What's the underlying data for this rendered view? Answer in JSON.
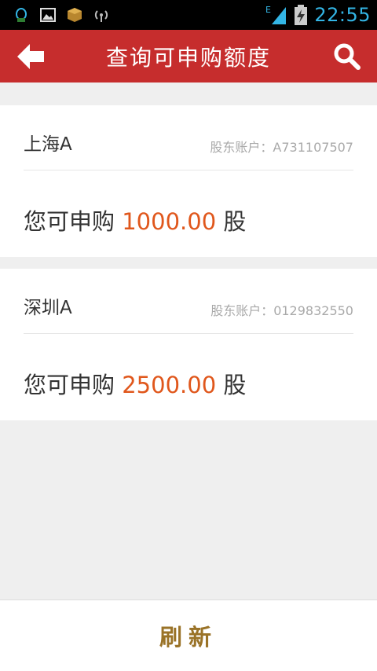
{
  "status_bar": {
    "time": "22:55",
    "network_type": "E",
    "icons": [
      "qq-icon",
      "image-icon",
      "package-icon",
      "wireless-icon",
      "signal-icon",
      "battery-charging-icon"
    ]
  },
  "header": {
    "title": "查询可申购额度",
    "back_icon": "arrow-left-icon",
    "search_icon": "search-icon",
    "bg_color": "#c62d2d"
  },
  "accounts": [
    {
      "market": "上海A",
      "account_label": "股东账户：A731107507",
      "quota_prefix": "您可申购",
      "quota_amount": "1000.00",
      "quota_unit": "股"
    },
    {
      "market": "深圳A",
      "account_label": "股东账户：0129832550",
      "quota_prefix": "您可申购",
      "quota_amount": "2500.00",
      "quota_unit": "股"
    }
  ],
  "footer": {
    "refresh_label": "刷新"
  },
  "colors": {
    "amount": "#e0571c",
    "refresh": "#9a7328"
  }
}
